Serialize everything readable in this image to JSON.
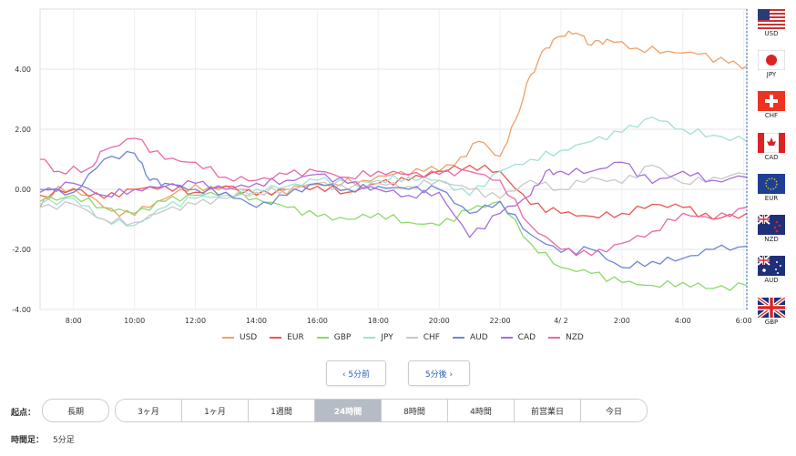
{
  "chart_data": {
    "type": "line",
    "ylim": [
      -4,
      6
    ],
    "y_ticks": [
      "4.00",
      "2.00",
      "0.00",
      "-2.00",
      "-4.00"
    ],
    "x_ticks": [
      "8:00",
      "10:00",
      "12:00",
      "14:00",
      "16:00",
      "18:00",
      "20:00",
      "22:00",
      "4/ 2",
      "2:00",
      "4:00",
      "6:00"
    ],
    "grid": true,
    "legend_position": "bottom",
    "series": [
      {
        "name": "USD",
        "color": "#f0a065",
        "points": [
          [
            6.9,
            -0.6
          ],
          [
            7.5,
            0.1
          ],
          [
            8.5,
            -0.2
          ],
          [
            9.5,
            -0.9
          ],
          [
            10.5,
            -0.6
          ],
          [
            11.5,
            0.0
          ],
          [
            12.5,
            0.1
          ],
          [
            13.5,
            0.0
          ],
          [
            14.5,
            -0.2
          ],
          [
            15.5,
            0.1
          ],
          [
            16.5,
            0.2
          ],
          [
            17.5,
            0.3
          ],
          [
            18.5,
            0.5
          ],
          [
            19.5,
            0.6
          ],
          [
            20.5,
            0.8
          ],
          [
            21.3,
            1.6
          ],
          [
            22.0,
            1.1
          ],
          [
            22.5,
            2.3
          ],
          [
            23.0,
            3.8
          ],
          [
            23.5,
            4.7
          ],
          [
            24.0,
            5.1
          ],
          [
            24.5,
            5.2
          ],
          [
            25.0,
            4.8
          ],
          [
            25.5,
            5.0
          ],
          [
            26.5,
            4.7
          ],
          [
            27.5,
            4.6
          ],
          [
            28.5,
            4.5
          ],
          [
            29.5,
            4.2
          ],
          [
            30.1,
            4.1
          ]
        ]
      },
      {
        "name": "EUR",
        "color": "#e8584f",
        "points": [
          [
            6.9,
            -0.2
          ],
          [
            8,
            0.0
          ],
          [
            9,
            -0.3
          ],
          [
            10,
            0.0
          ],
          [
            11,
            0.1
          ],
          [
            12,
            -0.1
          ],
          [
            13,
            0.1
          ],
          [
            14,
            -0.2
          ],
          [
            15,
            0.0
          ],
          [
            16,
            0.1
          ],
          [
            17,
            -0.1
          ],
          [
            18,
            0.2
          ],
          [
            19,
            0.3
          ],
          [
            20,
            0.6
          ],
          [
            21,
            0.8
          ],
          [
            22,
            0.6
          ],
          [
            23,
            -0.5
          ],
          [
            24,
            -0.8
          ],
          [
            25,
            -0.9
          ],
          [
            26,
            -0.8
          ],
          [
            27,
            -0.5
          ],
          [
            28,
            -0.6
          ],
          [
            29,
            -1.0
          ],
          [
            30.1,
            -0.8
          ]
        ]
      },
      {
        "name": "GBP",
        "color": "#8ed86c",
        "points": [
          [
            6.9,
            -0.4
          ],
          [
            8,
            -0.2
          ],
          [
            9,
            -0.6
          ],
          [
            10,
            -0.8
          ],
          [
            11,
            -0.4
          ],
          [
            12,
            -0.2
          ],
          [
            13,
            -0.1
          ],
          [
            14,
            -0.3
          ],
          [
            15,
            -0.6
          ],
          [
            16,
            -0.9
          ],
          [
            17,
            -1.0
          ],
          [
            18,
            -0.8
          ],
          [
            19,
            -1.1
          ],
          [
            20,
            -1.2
          ],
          [
            21,
            -0.7
          ],
          [
            22,
            -0.4
          ],
          [
            23,
            -1.8
          ],
          [
            24,
            -2.6
          ],
          [
            25,
            -2.8
          ],
          [
            26,
            -3.1
          ],
          [
            27,
            -3.2
          ],
          [
            28,
            -3.1
          ],
          [
            29,
            -3.3
          ],
          [
            30.1,
            -3.2
          ]
        ]
      },
      {
        "name": "JPY",
        "color": "#9fe0d8",
        "points": [
          [
            6.9,
            -0.5
          ],
          [
            8,
            -0.3
          ],
          [
            9,
            -1.0
          ],
          [
            10,
            -1.2
          ],
          [
            11,
            -0.6
          ],
          [
            12,
            -0.3
          ],
          [
            13,
            -0.2
          ],
          [
            14,
            0.0
          ],
          [
            15,
            0.1
          ],
          [
            16,
            0.3
          ],
          [
            17,
            0.2
          ],
          [
            18,
            0.3
          ],
          [
            19,
            0.4
          ],
          [
            20,
            0.3
          ],
          [
            21,
            -0.2
          ],
          [
            22,
            0.6
          ],
          [
            23,
            1.0
          ],
          [
            24,
            1.3
          ],
          [
            25,
            1.6
          ],
          [
            26,
            1.9
          ],
          [
            27,
            2.4
          ],
          [
            28,
            2.0
          ],
          [
            29,
            1.8
          ],
          [
            30.1,
            1.6
          ]
        ]
      },
      {
        "name": "CHF",
        "color": "#c8c8c8",
        "points": [
          [
            6.9,
            -0.6
          ],
          [
            8,
            -0.5
          ],
          [
            9,
            -1.0
          ],
          [
            10,
            -1.1
          ],
          [
            11,
            -0.7
          ],
          [
            12,
            -0.5
          ],
          [
            13,
            -0.3
          ],
          [
            14,
            -0.1
          ],
          [
            15,
            0.0
          ],
          [
            16,
            0.2
          ],
          [
            17,
            0.0
          ],
          [
            18,
            0.2
          ],
          [
            19,
            0.1
          ],
          [
            20,
            0.3
          ],
          [
            21,
            0.0
          ],
          [
            22,
            -0.3
          ],
          [
            23,
            0.3
          ],
          [
            24,
            0.0
          ],
          [
            25,
            0.4
          ],
          [
            26,
            0.2
          ],
          [
            27,
            0.8
          ],
          [
            28,
            0.2
          ],
          [
            29,
            0.4
          ],
          [
            30.1,
            0.5
          ]
        ]
      },
      {
        "name": "AUD",
        "color": "#6f84d6",
        "points": [
          [
            6.9,
            0.0
          ],
          [
            8,
            -0.1
          ],
          [
            9,
            1.0
          ],
          [
            10,
            1.2
          ],
          [
            10.5,
            0.3
          ],
          [
            11,
            0.2
          ],
          [
            12,
            0.0
          ],
          [
            13,
            -0.1
          ],
          [
            14,
            -0.6
          ],
          [
            15,
            -0.2
          ],
          [
            16,
            0.2
          ],
          [
            17,
            0.0
          ],
          [
            18,
            0.1
          ],
          [
            19,
            0.0
          ],
          [
            20,
            0.0
          ],
          [
            21,
            -0.8
          ],
          [
            22,
            -0.4
          ],
          [
            23,
            -1.5
          ],
          [
            24,
            -2.1
          ],
          [
            25,
            -2.0
          ],
          [
            26,
            -2.6
          ],
          [
            27,
            -2.4
          ],
          [
            28,
            -2.3
          ],
          [
            29,
            -2.0
          ],
          [
            30.1,
            -1.9
          ]
        ]
      },
      {
        "name": "CAD",
        "color": "#a86ed8",
        "points": [
          [
            6.9,
            -0.1
          ],
          [
            8,
            0.2
          ],
          [
            9,
            -0.2
          ],
          [
            10,
            0.0
          ],
          [
            11,
            0.1
          ],
          [
            12,
            0.2
          ],
          [
            13,
            0.0
          ],
          [
            14,
            0.2
          ],
          [
            15,
            0.3
          ],
          [
            16,
            0.5
          ],
          [
            17,
            0.2
          ],
          [
            18,
            0.0
          ],
          [
            19,
            -0.2
          ],
          [
            20,
            -0.1
          ],
          [
            21,
            -1.6
          ],
          [
            22,
            -0.8
          ],
          [
            23,
            -0.2
          ],
          [
            23.5,
            0.6
          ],
          [
            24,
            0.6
          ],
          [
            25,
            0.6
          ],
          [
            26,
            0.9
          ],
          [
            27,
            0.2
          ],
          [
            28,
            0.6
          ],
          [
            29,
            0.3
          ],
          [
            30.1,
            0.4
          ]
        ]
      },
      {
        "name": "NZD",
        "color": "#e868a8",
        "points": [
          [
            6.9,
            1.0
          ],
          [
            7.5,
            0.6
          ],
          [
            8.5,
            0.7
          ],
          [
            9,
            1.3
          ],
          [
            10,
            1.7
          ],
          [
            11,
            1.0
          ],
          [
            12,
            0.9
          ],
          [
            13,
            0.4
          ],
          [
            14,
            0.3
          ],
          [
            15,
            0.5
          ],
          [
            16,
            0.6
          ],
          [
            17,
            0.4
          ],
          [
            18,
            0.6
          ],
          [
            19,
            0.5
          ],
          [
            20,
            0.5
          ],
          [
            21,
            0.6
          ],
          [
            22,
            0.3
          ],
          [
            23,
            -1.2
          ],
          [
            24,
            -2.0
          ],
          [
            25,
            -2.2
          ],
          [
            26,
            -1.8
          ],
          [
            27,
            -1.4
          ],
          [
            28,
            -0.8
          ],
          [
            29,
            -1.0
          ],
          [
            30.1,
            -0.6
          ]
        ]
      }
    ]
  },
  "flags": [
    {
      "code": "USD",
      "icon": "us-flag"
    },
    {
      "code": "JPY",
      "icon": "jp-flag"
    },
    {
      "code": "CHF",
      "icon": "ch-flag"
    },
    {
      "code": "CAD",
      "icon": "ca-flag"
    },
    {
      "code": "EUR",
      "icon": "eu-flag"
    },
    {
      "code": "NZD",
      "icon": "nz-flag"
    },
    {
      "code": "AUD",
      "icon": "au-flag"
    },
    {
      "code": "GBP",
      "icon": "gb-flag"
    }
  ],
  "nav": {
    "prev_label": "‹ 5分前",
    "next_label": "5分後 ›"
  },
  "controls": {
    "start_label": "起点：",
    "long_term": "長期",
    "ranges": [
      "3ヶ月",
      "1ヶ月",
      "1週間",
      "24時間",
      "8時間",
      "4時間",
      "前営業日",
      "今日"
    ],
    "active_range": "24時間"
  },
  "footer": {
    "label": "時間足：",
    "value": "5分足"
  }
}
